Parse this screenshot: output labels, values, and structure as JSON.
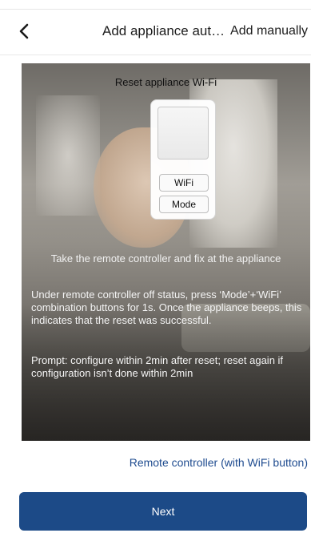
{
  "header": {
    "title": "Add appliance auto...",
    "add_manually_label": "Add manually"
  },
  "panel": {
    "title": "Reset appliance Wi-Fi",
    "remote": {
      "wifi_button_label": "WiFi",
      "mode_button_label": "Mode"
    },
    "instruction_main": "Take the remote controller and fix at the appliance",
    "instruction_body": "Under remote controller off status, press ‘Mode’+‘WiFi’ combination buttons for 1s. Once the appliance beeps, this indicates that the reset was successful.",
    "instruction_prompt": "Prompt: configure within 2min after reset; reset again if configuration isn’t done within 2min"
  },
  "footer": {
    "remote_link_label": "Remote controller (with WiFi button)",
    "next_label": "Next"
  },
  "icons": {
    "back": "chevron-left-icon"
  },
  "colors": {
    "primary": "#1c4a87",
    "link": "#1e4b8f"
  }
}
